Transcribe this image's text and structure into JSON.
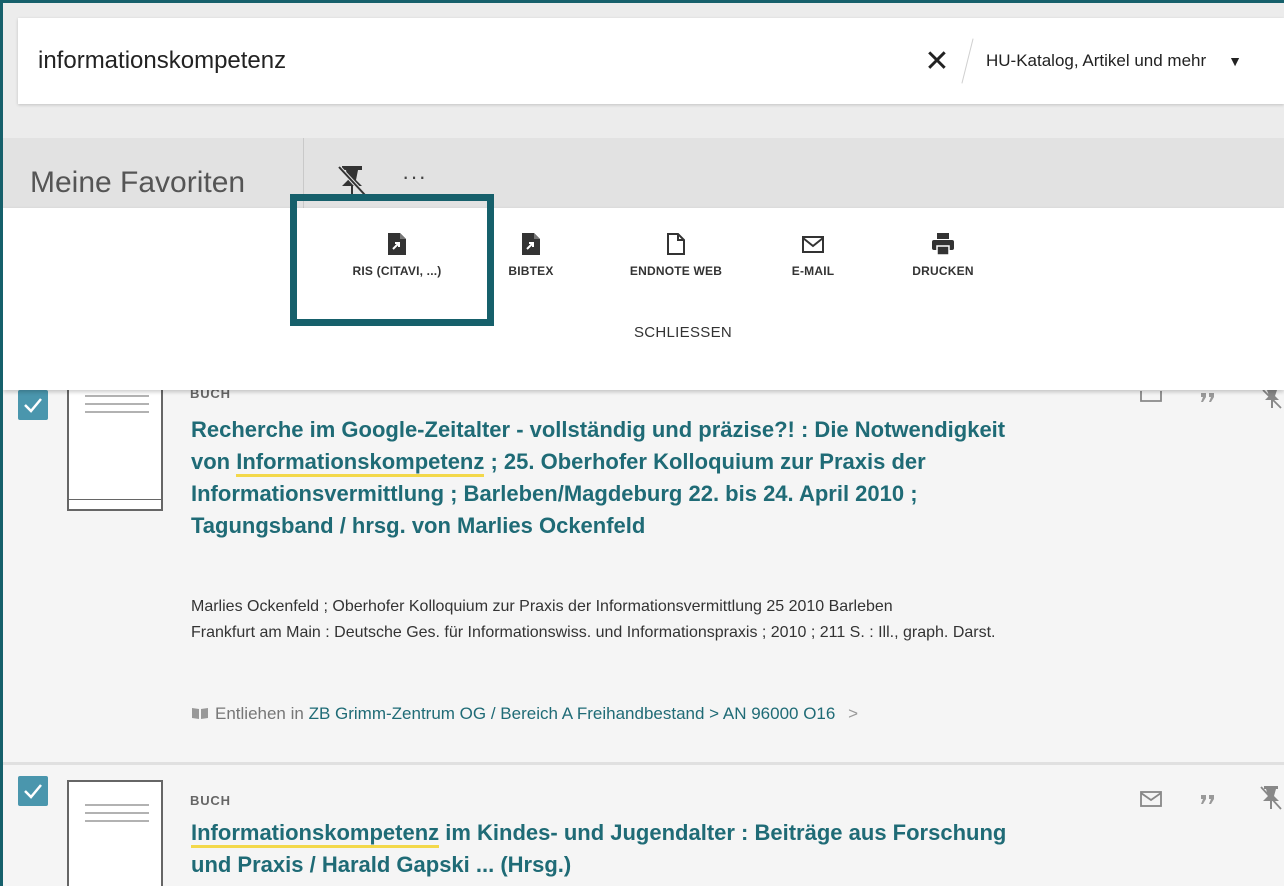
{
  "search": {
    "query": "informationskompetenz",
    "clear_symbol": "✕",
    "scope": "HU-Katalog, Artikel und mehr",
    "scope_caret": "▼"
  },
  "favorites": {
    "title": "Meine Favoriten",
    "more": "···"
  },
  "actions": {
    "ris": "RIS (CITAVI, ...)",
    "bibtex": "BIBTEX",
    "endnote": "ENDNOTE WEB",
    "email": "E-MAIL",
    "print": "DRUCKEN",
    "close": "SCHLIESSEN"
  },
  "results": [
    {
      "type": "BUCH",
      "title_before": "Recherche im Google-Zeitalter - vollständig und präzise?! : Die Notwendigkeit von ",
      "title_highlight": "Informationskompetenz",
      "title_after": " ; 25. Oberhofer Kolloquium zur Praxis der Informationsvermittlung ; Barleben/Magdeburg 22. bis 24. April 2010 ; Tagungsband / hrsg. von Marlies Ockenfeld",
      "authors": "Marlies Ockenfeld ; Oberhofer Kolloquium zur Praxis der Informationsvermittlung 25 2010 Barleben",
      "publication": "Frankfurt am Main : Deutsche Ges. für Informationswiss. und Informationspraxis ; 2010 ; 211 S. : Ill., graph. Darst.",
      "availability_prefix": "Entliehen in ",
      "availability_location": "ZB Grimm-Zentrum  OG / Bereich A Freihandbestand > AN 96000 O16",
      "availability_chevron": ">"
    },
    {
      "type": "BUCH",
      "title_highlight": "Informationskompetenz",
      "title_after": " im Kindes- und Jugendalter : Beiträge aus Forschung und Praxis / Harald Gapski ... (Hrsg.)"
    }
  ],
  "colors": {
    "teal_frame": "#16606b",
    "link": "#1f6b76",
    "checkbox": "#4a96ad",
    "highlight_underline": "#f3d84a"
  },
  "icons": {
    "clear": "close-icon",
    "scope": "chevron-down-icon",
    "unpin": "unpin-icon",
    "more": "more-dots-icon",
    "ris": "file-export-icon",
    "bibtex": "file-export-icon",
    "endnote": "document-icon",
    "email": "envelope-icon",
    "print": "printer-icon",
    "quote": "quote-icon",
    "book": "book-icon",
    "availability": "book-open-icon"
  }
}
